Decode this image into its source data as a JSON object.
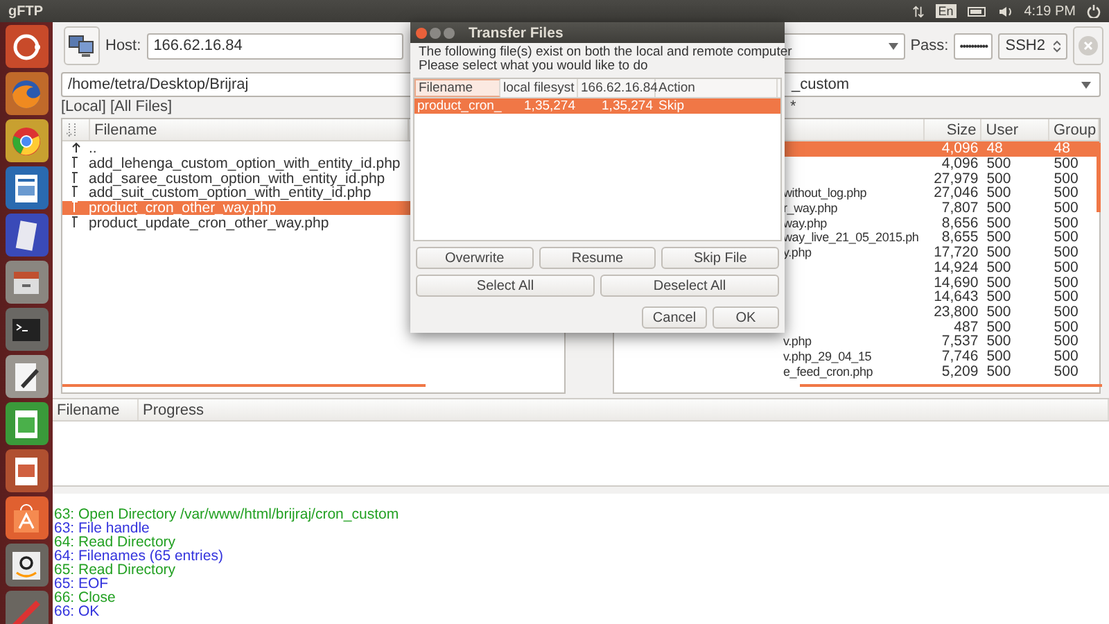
{
  "top_bar": {
    "app_title": "gFTP",
    "keyboard": "En",
    "time": "4:19 PM"
  },
  "toolbar": {
    "host_label": "Host:",
    "host": "166.62.16.84",
    "pass_label": "Pass:",
    "password": "••••••••••",
    "protocol": "SSH2"
  },
  "local_panel": {
    "path": "/home/tetra/Desktop/Brijraj",
    "filter": "[Local] [All Files]",
    "columns": [
      "Filename"
    ],
    "rows": [
      {
        "name": "..",
        "kind": "up",
        "selected": false
      },
      {
        "name": "add_lehenga_custom_option_with_entity_id.php",
        "kind": "file",
        "selected": false
      },
      {
        "name": "add_saree_custom_option_with_entity_id.php",
        "kind": "file",
        "selected": false
      },
      {
        "name": "add_suit_custom_option_with_entity_id.php",
        "kind": "file",
        "selected": false
      },
      {
        "name": "product_cron_other_way.php",
        "kind": "file",
        "selected": true
      },
      {
        "name": "product_update_cron_other_way.php",
        "kind": "file",
        "selected": false
      }
    ]
  },
  "remote_panel": {
    "path": "_custom",
    "filter": "*",
    "columns": [
      "Size",
      "User",
      "Group"
    ],
    "rows": [
      {
        "name": "",
        "size": "4,096",
        "user": "48",
        "group": "48",
        "selected": true
      },
      {
        "name": "",
        "size": "4,096",
        "user": "500",
        "group": "500",
        "selected": false
      },
      {
        "name": "",
        "size": "27,979",
        "user": "500",
        "group": "500",
        "selected": false
      },
      {
        "name": "without_log.php",
        "size": "27,046",
        "user": "500",
        "group": "500",
        "selected": false
      },
      {
        "name": "r_way.php",
        "size": "7,807",
        "user": "500",
        "group": "500",
        "selected": false
      },
      {
        "name": "way.php",
        "size": "8,656",
        "user": "500",
        "group": "500",
        "selected": false
      },
      {
        "name": "way_live_21_05_2015.ph",
        "size": "8,655",
        "user": "500",
        "group": "500",
        "selected": false
      },
      {
        "name": "y.php",
        "size": "17,720",
        "user": "500",
        "group": "500",
        "selected": false
      },
      {
        "name": "",
        "size": "14,924",
        "user": "500",
        "group": "500",
        "selected": false
      },
      {
        "name": "",
        "size": "14,690",
        "user": "500",
        "group": "500",
        "selected": false
      },
      {
        "name": "",
        "size": "14,643",
        "user": "500",
        "group": "500",
        "selected": false
      },
      {
        "name": "",
        "size": "23,800",
        "user": "500",
        "group": "500",
        "selected": false
      },
      {
        "name": "",
        "size": "487",
        "user": "500",
        "group": "500",
        "selected": false
      },
      {
        "name": "v.php",
        "size": "7,537",
        "user": "500",
        "group": "500",
        "selected": false
      },
      {
        "name": "v.php_29_04_15",
        "size": "7,746",
        "user": "500",
        "group": "500",
        "selected": false
      },
      {
        "name": "e_feed_cron.php",
        "size": "5,209",
        "user": "500",
        "group": "500",
        "selected": false
      }
    ]
  },
  "transfers": {
    "columns": [
      "Filename",
      "Progress"
    ]
  },
  "log": [
    {
      "text": "63: Open Directory /var/www/html/brijraj/cron_custom",
      "color": "#22a022"
    },
    {
      "text": "63: File handle",
      "color": "#3333dd"
    },
    {
      "text": "64: Read Directory",
      "color": "#22a022"
    },
    {
      "text": "64: Filenames (65 entries)",
      "color": "#3333dd"
    },
    {
      "text": "65: Read Directory",
      "color": "#22a022"
    },
    {
      "text": "65: EOF",
      "color": "#3333dd"
    },
    {
      "text": "66: Close",
      "color": "#22a022"
    },
    {
      "text": "66: OK",
      "color": "#3333dd"
    }
  ],
  "dialog": {
    "title": "Transfer Files",
    "message": [
      "The following file(s) exist on both the local and remote computer",
      "Please select what you would like to do"
    ],
    "columns": [
      "Filename",
      "local filesyst",
      "166.62.16.84",
      "Action"
    ],
    "rows": [
      {
        "cells": [
          "product_cron_",
          "1,35,274",
          "1,35,274",
          "Skip"
        ],
        "selected": true
      }
    ],
    "buttons_row_1": [
      "Overwrite",
      "Resume",
      "Skip File"
    ],
    "buttons_row_2": [
      "Select All",
      "Deselect All"
    ],
    "buttons_row_3": [
      "Cancel",
      "OK"
    ]
  }
}
